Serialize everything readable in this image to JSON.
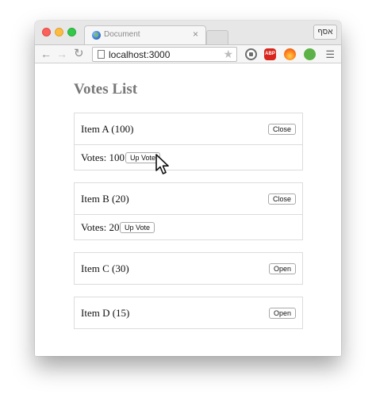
{
  "browser": {
    "tab_title": "Document",
    "tab_close": "×",
    "profile_label": "אסף",
    "url": "localhost:3000",
    "ext_abp": "ABP"
  },
  "page": {
    "title": "Votes List",
    "items": [
      {
        "label": "Item A (100)",
        "toggle": "Close",
        "votes": "Votes: 100",
        "upvote": "Up Vote"
      },
      {
        "label": "Item B (20)",
        "toggle": "Close",
        "votes": "Votes: 20",
        "upvote": "Up Vote"
      },
      {
        "label": "Item C (30)",
        "toggle": "Open"
      },
      {
        "label": "Item D (15)",
        "toggle": "Open"
      }
    ]
  }
}
